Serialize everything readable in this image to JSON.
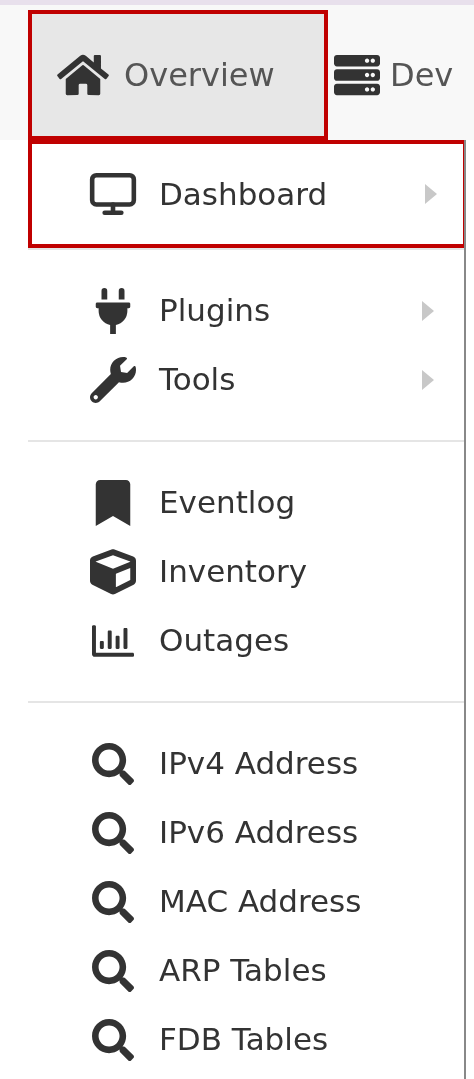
{
  "navbar": {
    "tabs": [
      {
        "label": "Overview",
        "selected": true,
        "highlighted": true
      },
      {
        "label": "Dev",
        "selected": false,
        "highlighted": false
      }
    ]
  },
  "menu": {
    "sections": [
      {
        "items": [
          {
            "label": "Dashboard",
            "submenu": true,
            "highlighted": true
          }
        ]
      },
      {
        "items": [
          {
            "label": "Plugins",
            "submenu": true,
            "highlighted": false
          },
          {
            "label": "Tools",
            "submenu": true,
            "highlighted": false
          }
        ]
      },
      {
        "items": [
          {
            "label": "Eventlog",
            "submenu": false,
            "highlighted": false
          },
          {
            "label": "Inventory",
            "submenu": false,
            "highlighted": false
          },
          {
            "label": "Outages",
            "submenu": false,
            "highlighted": false
          }
        ]
      },
      {
        "items": [
          {
            "label": "IPv4 Address",
            "submenu": false,
            "highlighted": false
          },
          {
            "label": "IPv6 Address",
            "submenu": false,
            "highlighted": false
          },
          {
            "label": "MAC Address",
            "submenu": false,
            "highlighted": false
          },
          {
            "label": "ARP Tables",
            "submenu": false,
            "highlighted": false
          },
          {
            "label": "FDB Tables",
            "submenu": false,
            "highlighted": false
          }
        ]
      }
    ]
  }
}
